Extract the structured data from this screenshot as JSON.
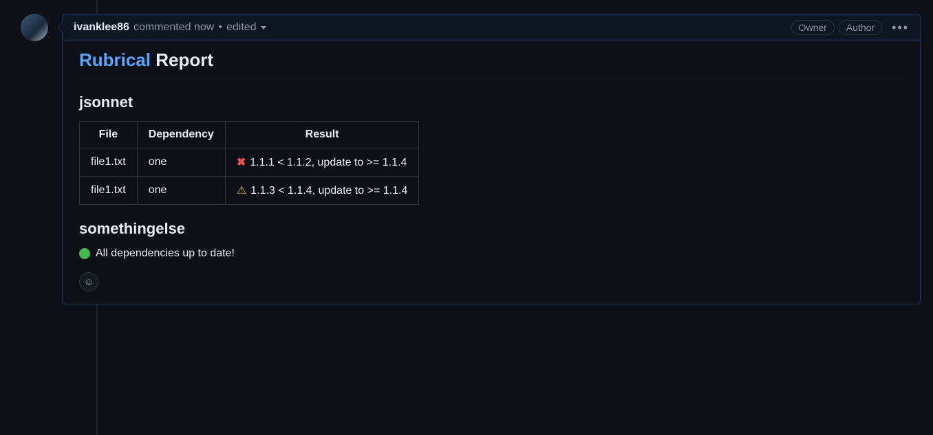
{
  "comment": {
    "author": "ivanklee86",
    "action": "commented",
    "timestamp": "now",
    "edited_label": "edited",
    "badges": [
      "Owner",
      "Author"
    ]
  },
  "report": {
    "title_link": "Rubrical",
    "title_rest": "Report",
    "sections": [
      {
        "name": "jsonnet",
        "columns": [
          "File",
          "Dependency",
          "Result"
        ],
        "rows": [
          {
            "file": "file1.txt",
            "dependency": "one",
            "status": "error",
            "result": "1.1.1 < 1.1.2, update to >= 1.1.4"
          },
          {
            "file": "file1.txt",
            "dependency": "one",
            "status": "warn",
            "result": "1.1.3 < 1.1.4, update to >= 1.1.4"
          }
        ]
      },
      {
        "name": "somethingelse",
        "ok_message": "All dependencies up to date!"
      }
    ]
  }
}
